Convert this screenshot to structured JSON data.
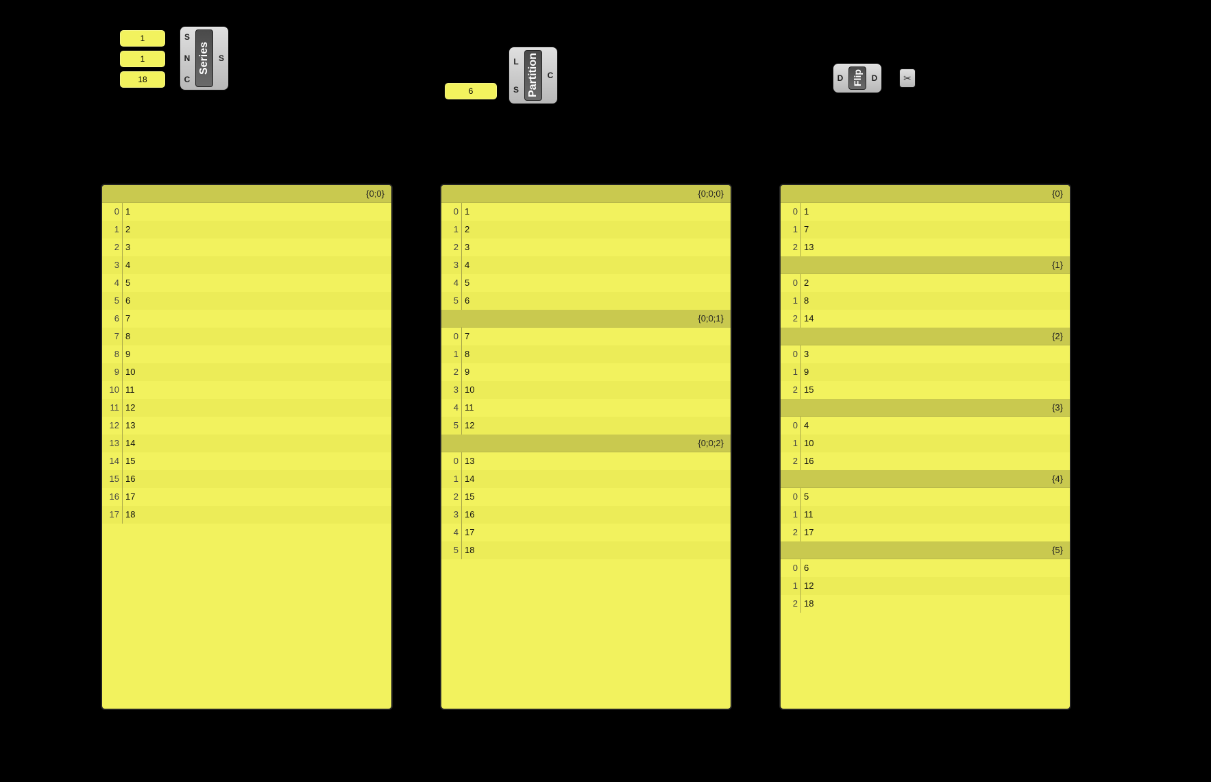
{
  "params": {
    "series_S": "1",
    "series_N": "1",
    "series_C": "18",
    "partition_S": "6"
  },
  "components": {
    "series": {
      "label": "Series",
      "inputs": [
        "S",
        "N",
        "C"
      ],
      "outputs": [
        "S"
      ]
    },
    "partition": {
      "label": "Partition",
      "inputs": [
        "L",
        "S"
      ],
      "outputs": [
        "C"
      ]
    },
    "flip": {
      "label": "Flip",
      "inputs": [
        "D"
      ],
      "outputs": [
        "D"
      ]
    }
  },
  "panel_series": {
    "branches": [
      {
        "path": "{0;0}",
        "items": [
          "1",
          "2",
          "3",
          "4",
          "5",
          "6",
          "7",
          "8",
          "9",
          "10",
          "11",
          "12",
          "13",
          "14",
          "15",
          "16",
          "17",
          "18"
        ]
      }
    ]
  },
  "panel_partition": {
    "branches": [
      {
        "path": "{0;0;0}",
        "items": [
          "1",
          "2",
          "3",
          "4",
          "5",
          "6"
        ]
      },
      {
        "path": "{0;0;1}",
        "items": [
          "7",
          "8",
          "9",
          "10",
          "11",
          "12"
        ]
      },
      {
        "path": "{0;0;2}",
        "items": [
          "13",
          "14",
          "15",
          "16",
          "17",
          "18"
        ]
      }
    ]
  },
  "panel_flip": {
    "branches": [
      {
        "path": "{0}",
        "items": [
          "1",
          "7",
          "13"
        ]
      },
      {
        "path": "{1}",
        "items": [
          "2",
          "8",
          "14"
        ]
      },
      {
        "path": "{2}",
        "items": [
          "3",
          "9",
          "15"
        ]
      },
      {
        "path": "{3}",
        "items": [
          "4",
          "10",
          "16"
        ]
      },
      {
        "path": "{4}",
        "items": [
          "5",
          "11",
          "17"
        ]
      },
      {
        "path": "{5}",
        "items": [
          "6",
          "12",
          "18"
        ]
      }
    ]
  }
}
